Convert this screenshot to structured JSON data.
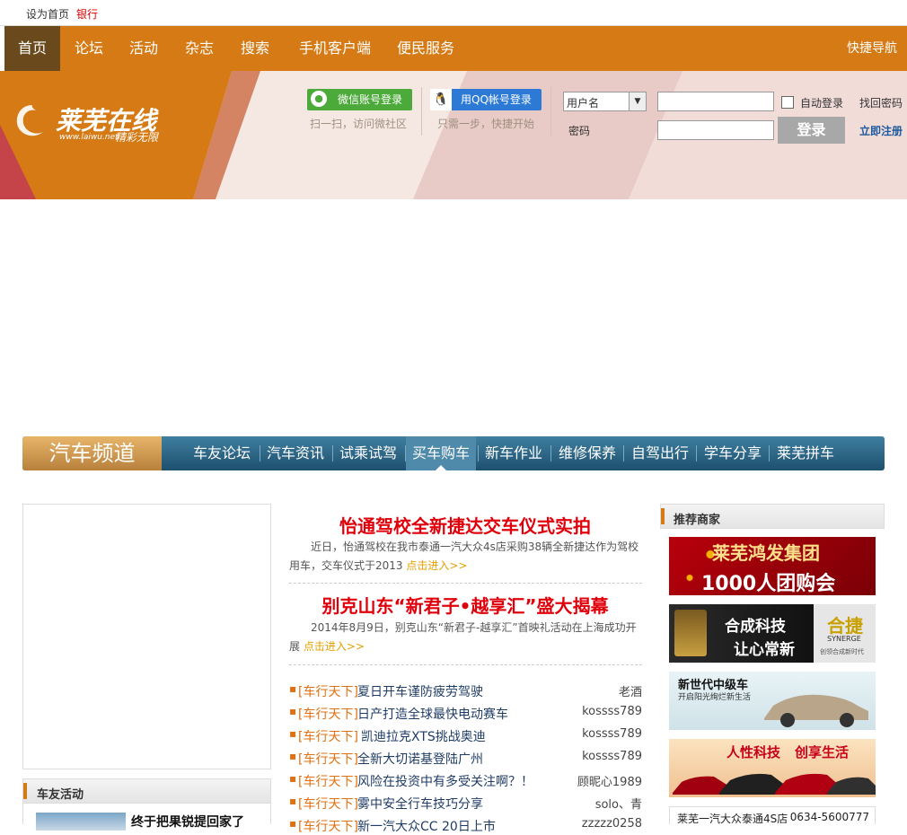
{
  "topbar": {
    "set_home": "设为首页",
    "bank": "银行"
  },
  "nav": {
    "items": [
      "首页",
      "论坛",
      "活动",
      "杂志",
      "搜索",
      "手机客户端",
      "便民服务"
    ],
    "quick": "快捷导航"
  },
  "banner": {
    "logo_text": "莱芜在线",
    "logo_url": "www.laiwu.net",
    "logo_slogan": "精彩无限",
    "wechat_btn": "微信账号登录",
    "wechat_hint": "扫一扫，访问微社区",
    "qq_btn": "用QQ帐号登录",
    "qq_hint": "只需一步，快捷开始",
    "username_select": "用户名",
    "password_label": "密码",
    "auto_login": "自动登录",
    "find_password": "找回密码",
    "login_btn": "登录",
    "register": "立即注册"
  },
  "auto": {
    "title": "汽车频道",
    "tabs": [
      "车友论坛",
      "汽车资讯",
      "试乘试驾",
      "买车购车",
      "新车作业",
      "维修保养",
      "自驾出行",
      "学车分享",
      "莱芜拼车"
    ],
    "active_tab": 3
  },
  "left": {
    "activity_title": "车友活动",
    "activity_item": "终于把果锐提回家了"
  },
  "center": {
    "headline1": "怡通驾校全新捷达交车仪式实拍",
    "summary1": "近日，怡通驾校在我市泰通一汽大众4s店采购38辆全新捷达作为驾校用车，交车仪式于2013",
    "headline2": "别克山东“新君子•越享汇”盛大揭幕",
    "summary2": "2014年8月9日，别克山东“新君子-越享汇”首映礼活动在上海成功开展",
    "more": "点击进入>>",
    "news": [
      {
        "cat": "[车行天下]",
        "title": "夏日开车谨防疲劳驾驶",
        "author": "老酒"
      },
      {
        "cat": "[车行天下]",
        "title": "日产打造全球最快电动赛车",
        "author": "kossss789"
      },
      {
        "cat": "[车行天下]",
        "title": "凯迪拉克XTS挑战奥迪",
        "author": "kossss789"
      },
      {
        "cat": "[车行天下]",
        "title": "全新大切诺基登陆广州",
        "author": "kossss789"
      },
      {
        "cat": "[车行天下]",
        "title": "风险在投资中有多受关注啊？！",
        "author": "顾昵心1989"
      },
      {
        "cat": "[车行天下]",
        "title": "雾中安全行车技巧分享",
        "author": "solo、青"
      },
      {
        "cat": "[车行天下]",
        "title": "新一汽大众CC 20日上市",
        "author": "zzzzz0258"
      }
    ]
  },
  "right": {
    "title": "推荐商家",
    "ads": [
      {
        "line1": "莱芜鸿发集团",
        "line2": "1000人团购会"
      },
      {
        "line1": "合成科技",
        "line2": "让心常新",
        "brand": "合捷",
        "brand_en": "SYNERGE",
        "tagline": "创领合成新时代"
      },
      {
        "line1": "新世代中级车",
        "line2": "开启阳光绚烂新生活"
      },
      {
        "line1": "人性科技",
        "line2": "创享生活"
      }
    ],
    "dealer_name": "莱芜一汽大众泰通4S店",
    "dealer_phone": "0634-5600777"
  },
  "colors": {
    "nav": "#d57a14",
    "accent_red": "#e0000b",
    "link_blue": "#1f3c66",
    "orange": "#e07010"
  }
}
